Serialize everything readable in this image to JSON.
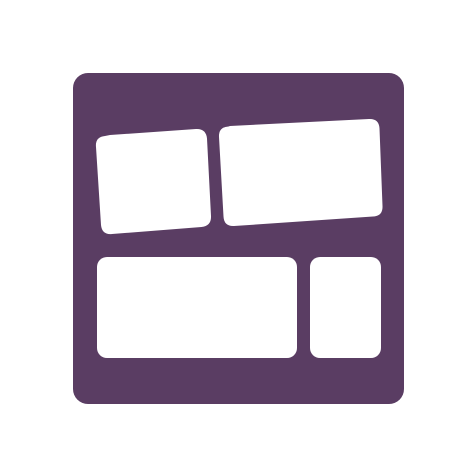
{
  "logo": {
    "icon": "layout-collage-icon",
    "colors": {
      "frame": "#5a3d63",
      "tile": "#ffffff",
      "background": "#ffffff"
    }
  }
}
